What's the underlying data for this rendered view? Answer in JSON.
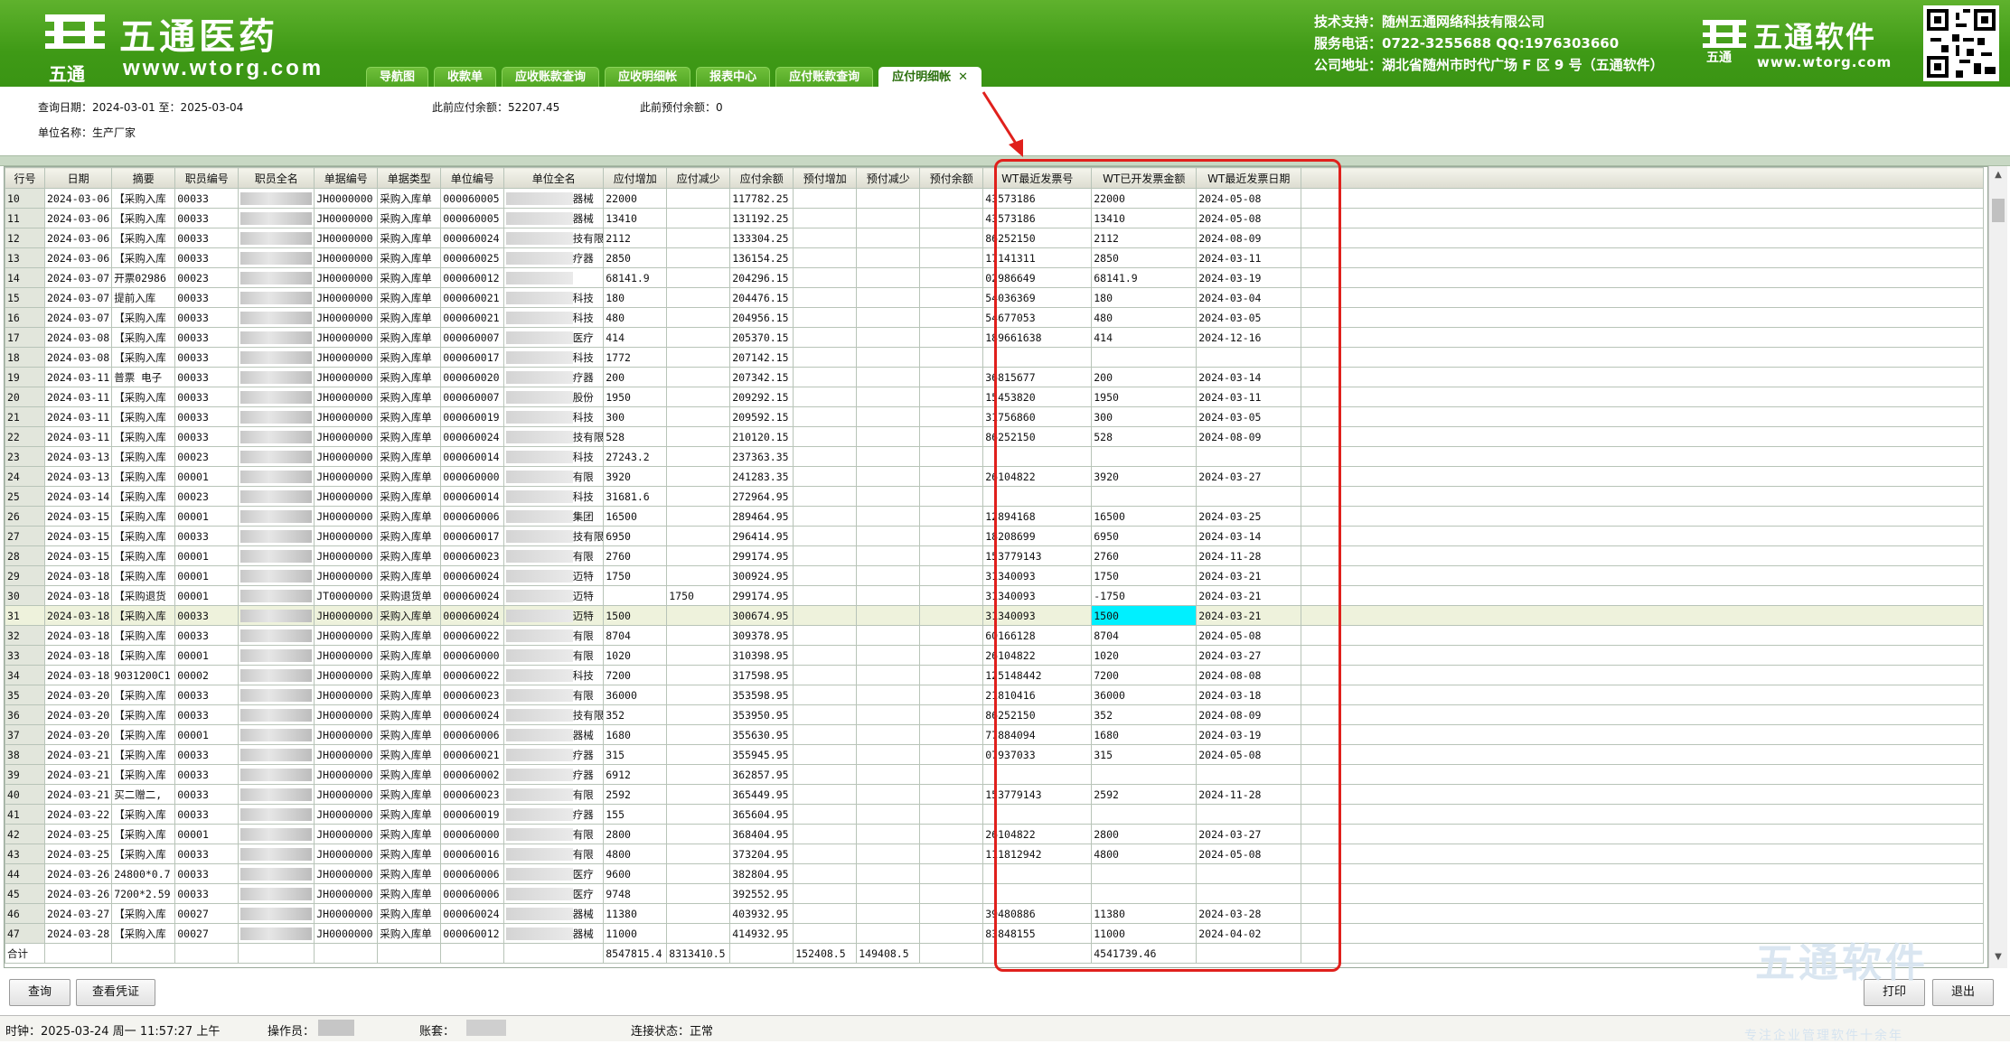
{
  "header": {
    "logo_text": "五通医药",
    "logo_url": "www.wtorg.com",
    "logo_sub": "五通",
    "company_lines": [
      "技术支持：随州五通网络科技有限公司",
      "服务电话：0722-3255688  QQ:1976303660",
      "公司地址：湖北省随州市时代广场 F 区 9 号（五通软件）"
    ],
    "brand_text": "五通软件",
    "brand_url": "www.wtorg.com",
    "brand_sub": "五通"
  },
  "tabs": [
    {
      "label": "导航图"
    },
    {
      "label": "收款单"
    },
    {
      "label": "应收账款查询"
    },
    {
      "label": "应收明细帐"
    },
    {
      "label": "报表中心"
    },
    {
      "label": "应付账款查询"
    },
    {
      "label": "应付明细帐",
      "close": "✕"
    }
  ],
  "info": {
    "date_label": "查询日期：2024-03-01  至：2025-03-04",
    "prev_payable": "此前应付余额：52207.45",
    "prev_prepay": "此前预付余额：0",
    "unit_name": "单位名称：生产厂家"
  },
  "table": {
    "headers": [
      "行号",
      "日期",
      "摘要",
      "职员编号",
      "职员全名",
      "单据编号",
      "单据类型",
      "单位编号",
      "单位全名",
      "应付增加",
      "应付减少",
      "应付余额",
      "预付增加",
      "预付减少",
      "预付余额",
      "WT最近发票号",
      "WT已开发票金额",
      "WT最近发票日期"
    ],
    "rows": [
      [
        "10",
        "2024-03-06",
        "【采购入库",
        "00033",
        "",
        "JH0000000",
        "采购入库单",
        "000060005",
        "器械",
        "22000",
        "",
        "117782.25",
        "",
        "",
        "",
        "43573186",
        "22000",
        "2024-05-08"
      ],
      [
        "11",
        "2024-03-06",
        "【采购入库",
        "00033",
        "",
        "JH0000000",
        "采购入库单",
        "000060005",
        "器械",
        "13410",
        "",
        "131192.25",
        "",
        "",
        "",
        "43573186",
        "13410",
        "2024-05-08"
      ],
      [
        "12",
        "2024-03-06",
        "【采购入库",
        "00033",
        "",
        "JH0000000",
        "采购入库单",
        "000060024",
        "技有限",
        "2112",
        "",
        "133304.25",
        "",
        "",
        "",
        "86252150",
        "2112",
        "2024-08-09"
      ],
      [
        "13",
        "2024-03-06",
        "【采购入库",
        "00033",
        "",
        "JH0000000",
        "采购入库单",
        "000060025",
        "疗器",
        "2850",
        "",
        "136154.25",
        "",
        "",
        "",
        "17141311",
        "2850",
        "2024-03-11"
      ],
      [
        "14",
        "2024-03-07",
        "开票02986",
        "00023",
        "",
        "JH0000000",
        "采购入库单",
        "000060012",
        "",
        "68141.9",
        "",
        "204296.15",
        "",
        "",
        "",
        "02986649",
        "68141.9",
        "2024-03-19"
      ],
      [
        "15",
        "2024-03-07",
        "提前入库",
        "00033",
        "",
        "JH0000000",
        "采购入库单",
        "000060021",
        "科技",
        "180",
        "",
        "204476.15",
        "",
        "",
        "",
        "54036369",
        "180",
        "2024-03-04"
      ],
      [
        "16",
        "2024-03-07",
        "【采购入库",
        "00033",
        "",
        "JH0000000",
        "采购入库单",
        "000060021",
        "科技",
        "480",
        "",
        "204956.15",
        "",
        "",
        "",
        "54677053",
        "480",
        "2024-03-05"
      ],
      [
        "17",
        "2024-03-08",
        "【采购入库",
        "00033",
        "",
        "JH0000000",
        "采购入库单",
        "000060007",
        "医疗",
        "414",
        "",
        "205370.15",
        "",
        "",
        "",
        "189661638",
        "414",
        "2024-12-16"
      ],
      [
        "18",
        "2024-03-08",
        "【采购入库",
        "00033",
        "",
        "JH0000000",
        "采购入库单",
        "000060017",
        "科技",
        "1772",
        "",
        "207142.15",
        "",
        "",
        "",
        "",
        "",
        ""
      ],
      [
        "19",
        "2024-03-11",
        "普票 电子",
        "00033",
        "",
        "JH0000000",
        "采购入库单",
        "000060020",
        "疗器",
        "200",
        "",
        "207342.15",
        "",
        "",
        "",
        "36815677",
        "200",
        "2024-03-14"
      ],
      [
        "20",
        "2024-03-11",
        "【采购入库",
        "00033",
        "",
        "JH0000000",
        "采购入库单",
        "000060007",
        "股份",
        "1950",
        "",
        "209292.15",
        "",
        "",
        "",
        "15453820",
        "1950",
        "2024-03-11"
      ],
      [
        "21",
        "2024-03-11",
        "【采购入库",
        "00033",
        "",
        "JH0000000",
        "采购入库单",
        "000060019",
        "科技",
        "300",
        "",
        "209592.15",
        "",
        "",
        "",
        "31756860",
        "300",
        "2024-03-05"
      ],
      [
        "22",
        "2024-03-11",
        "【采购入库",
        "00033",
        "",
        "JH0000000",
        "采购入库单",
        "000060024",
        "技有限",
        "528",
        "",
        "210120.15",
        "",
        "",
        "",
        "86252150",
        "528",
        "2024-08-09"
      ],
      [
        "23",
        "2024-03-13",
        "【采购入库",
        "00023",
        "",
        "JH0000000",
        "采购入库单",
        "000060014",
        "科技",
        "27243.2",
        "",
        "237363.35",
        "",
        "",
        "",
        "",
        "",
        ""
      ],
      [
        "24",
        "2024-03-13",
        "【采购入库",
        "00001",
        "",
        "JH0000000",
        "采购入库单",
        "000060000",
        "有限",
        "3920",
        "",
        "241283.35",
        "",
        "",
        "",
        "26104822",
        "3920",
        "2024-03-27"
      ],
      [
        "25",
        "2024-03-14",
        "【采购入库",
        "00023",
        "",
        "JH0000000",
        "采购入库单",
        "000060014",
        "科技",
        "31681.6",
        "",
        "272964.95",
        "",
        "",
        "",
        "",
        "",
        ""
      ],
      [
        "26",
        "2024-03-15",
        "【采购入库",
        "00001",
        "",
        "JH0000000",
        "采购入库单",
        "000060006",
        "集团",
        "16500",
        "",
        "289464.95",
        "",
        "",
        "",
        "12894168",
        "16500",
        "2024-03-25"
      ],
      [
        "27",
        "2024-03-15",
        "【采购入库",
        "00033",
        "",
        "JH0000000",
        "采购入库单",
        "000060017",
        "技有限",
        "6950",
        "",
        "296414.95",
        "",
        "",
        "",
        "18208699",
        "6950",
        "2024-03-14"
      ],
      [
        "28",
        "2024-03-15",
        "【采购入库",
        "00001",
        "",
        "JH0000000",
        "采购入库单",
        "000060023",
        "有限",
        "2760",
        "",
        "299174.95",
        "",
        "",
        "",
        "153779143",
        "2760",
        "2024-11-28"
      ],
      [
        "29",
        "2024-03-18",
        "【采购入库",
        "00001",
        "",
        "JH0000000",
        "采购入库单",
        "000060024",
        "迈特",
        "1750",
        "",
        "300924.95",
        "",
        "",
        "",
        "31340093",
        "1750",
        "2024-03-21"
      ],
      [
        "30",
        "2024-03-18",
        "【采购退货",
        "00001",
        "",
        "JT0000000",
        "采购退货单",
        "000060024",
        "迈特",
        "",
        "1750",
        "299174.95",
        "",
        "",
        "",
        "31340093",
        "-1750",
        "2024-03-21"
      ],
      [
        "31",
        "2024-03-18",
        "【采购入库",
        "00033",
        "",
        "JH0000000",
        "采购入库单",
        "000060024",
        "迈特",
        "1500",
        "",
        "300674.95",
        "",
        "",
        "",
        "31340093",
        "1500",
        "2024-03-21"
      ],
      [
        "32",
        "2024-03-18",
        "【采购入库",
        "00033",
        "",
        "JH0000000",
        "采购入库单",
        "000060022",
        "有限",
        "8704",
        "",
        "309378.95",
        "",
        "",
        "",
        "60166128",
        "8704",
        "2024-05-08"
      ],
      [
        "33",
        "2024-03-18",
        "【采购入库",
        "00001",
        "",
        "JH0000000",
        "采购入库单",
        "000060000",
        "有限",
        "1020",
        "",
        "310398.95",
        "",
        "",
        "",
        "26104822",
        "1020",
        "2024-03-27"
      ],
      [
        "34",
        "2024-03-18",
        "9031200C1",
        "00002",
        "",
        "JH0000000",
        "采购入库单",
        "000060022",
        "科技",
        "7200",
        "",
        "317598.95",
        "",
        "",
        "",
        "125148442",
        "7200",
        "2024-08-08"
      ],
      [
        "35",
        "2024-03-20",
        "【采购入库",
        "00033",
        "",
        "JH0000000",
        "采购入库单",
        "000060023",
        "有限",
        "36000",
        "",
        "353598.95",
        "",
        "",
        "",
        "21810416",
        "36000",
        "2024-03-18"
      ],
      [
        "36",
        "2024-03-20",
        "【采购入库",
        "00033",
        "",
        "JH0000000",
        "采购入库单",
        "000060024",
        "技有限",
        "352",
        "",
        "353950.95",
        "",
        "",
        "",
        "86252150",
        "352",
        "2024-08-09"
      ],
      [
        "37",
        "2024-03-20",
        "【采购入库",
        "00001",
        "",
        "JH0000000",
        "采购入库单",
        "000060006",
        "器械",
        "1680",
        "",
        "355630.95",
        "",
        "",
        "",
        "77884094",
        "1680",
        "2024-03-19"
      ],
      [
        "38",
        "2024-03-21",
        "【采购入库",
        "00033",
        "",
        "JH0000000",
        "采购入库单",
        "000060021",
        "疗器",
        "315",
        "",
        "355945.95",
        "",
        "",
        "",
        "07937033",
        "315",
        "2024-05-08"
      ],
      [
        "39",
        "2024-03-21",
        "【采购入库",
        "00033",
        "",
        "JH0000000",
        "采购入库单",
        "000060002",
        "疗器",
        "6912",
        "",
        "362857.95",
        "",
        "",
        "",
        "",
        "",
        ""
      ],
      [
        "40",
        "2024-03-21",
        "买二赠二,",
        "00033",
        "",
        "JH0000000",
        "采购入库单",
        "000060023",
        "有限",
        "2592",
        "",
        "365449.95",
        "",
        "",
        "",
        "153779143",
        "2592",
        "2024-11-28"
      ],
      [
        "41",
        "2024-03-22",
        "【采购入库",
        "00033",
        "",
        "JH0000000",
        "采购入库单",
        "000060019",
        "疗器",
        "155",
        "",
        "365604.95",
        "",
        "",
        "",
        "",
        "",
        ""
      ],
      [
        "42",
        "2024-03-25",
        "【采购入库",
        "00001",
        "",
        "JH0000000",
        "采购入库单",
        "000060000",
        "有限",
        "2800",
        "",
        "368404.95",
        "",
        "",
        "",
        "26104822",
        "2800",
        "2024-03-27"
      ],
      [
        "43",
        "2024-03-25",
        "【采购入库",
        "00033",
        "",
        "JH0000000",
        "采购入库单",
        "000060016",
        "有限",
        "4800",
        "",
        "373204.95",
        "",
        "",
        "",
        "111812942",
        "4800",
        "2024-05-08"
      ],
      [
        "44",
        "2024-03-26",
        "24800*0.7",
        "00033",
        "",
        "JH0000000",
        "采购入库单",
        "000060006",
        "医疗",
        "9600",
        "",
        "382804.95",
        "",
        "",
        "",
        "",
        "",
        ""
      ],
      [
        "45",
        "2024-03-26",
        "7200*2.59",
        "00033",
        "",
        "JH0000000",
        "采购入库单",
        "000060006",
        "医疗",
        "9748",
        "",
        "392552.95",
        "",
        "",
        "",
        "",
        "",
        ""
      ],
      [
        "46",
        "2024-03-27",
        "【采购入库",
        "00027",
        "",
        "JH0000000",
        "采购入库单",
        "000060024",
        "器械",
        "11380",
        "",
        "403932.95",
        "",
        "",
        "",
        "39480886",
        "11380",
        "2024-03-28"
      ],
      [
        "47",
        "2024-03-28",
        "【采购入库",
        "00027",
        "",
        "JH0000000",
        "采购入库单",
        "000060012",
        "器械",
        "11000",
        "",
        "414932.95",
        "",
        "",
        "",
        "83848155",
        "11000",
        "2024-04-02"
      ]
    ],
    "total": [
      "合计",
      "",
      "",
      "",
      "",
      "",
      "",
      "",
      "",
      "8547815.4",
      "8313410.5",
      "",
      "152408.5",
      "149408.5",
      "",
      "",
      "4541739.46",
      ""
    ]
  },
  "buttons": {
    "query": "查询",
    "voucher": "查看凭证",
    "print": "打印",
    "exit": "退出"
  },
  "status": {
    "time": "时钟：2025-03-24  周一 11:57:27 上午",
    "operator": "操作员：",
    "account": "账套：",
    "connection": "连接状态：正常"
  },
  "watermark": {
    "text": "五通软件",
    "sub": "专注企业管理软件十余年"
  },
  "colors": {
    "header_green": "#3f9a16",
    "highlight_red": "#e0201c",
    "selected_cell": "#00f0ff"
  }
}
